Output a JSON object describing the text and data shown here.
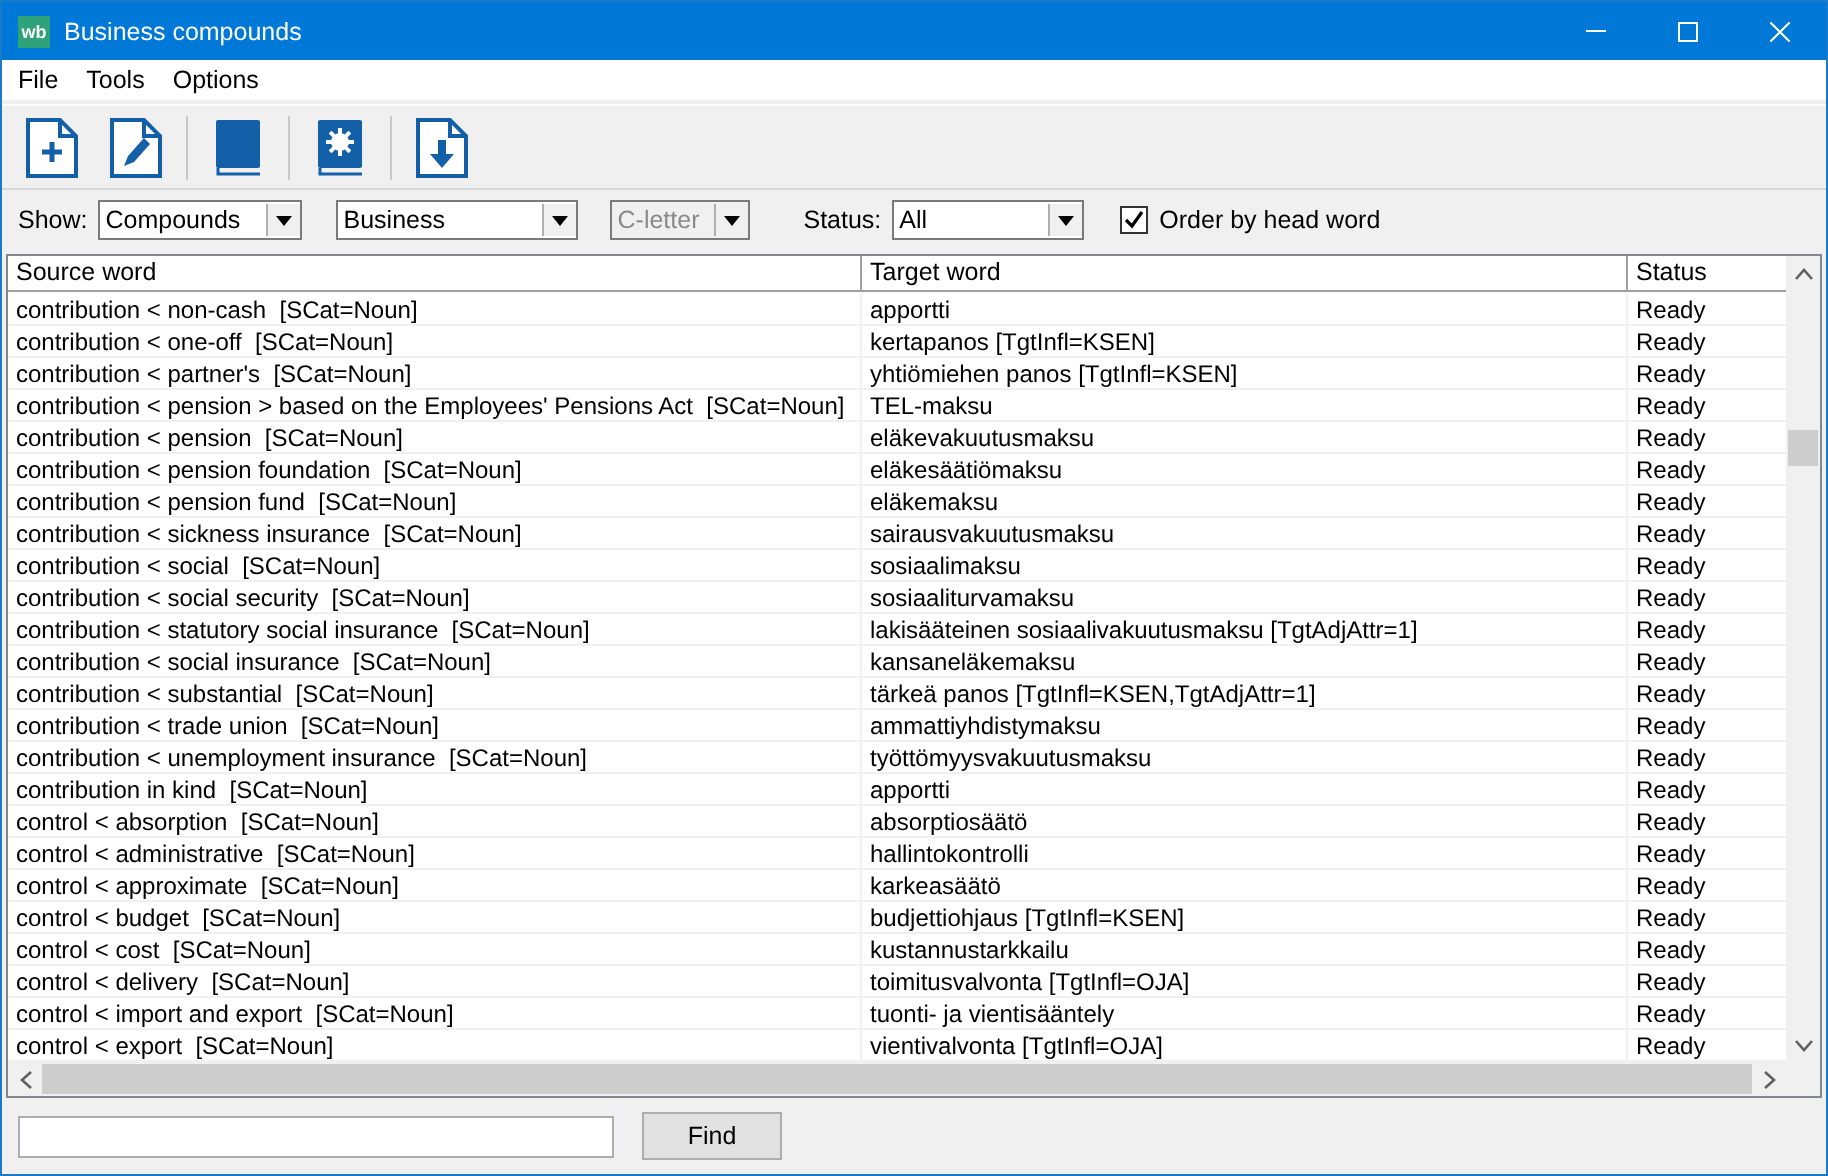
{
  "window": {
    "app_icon": "wb",
    "title": "Business compounds"
  },
  "menu": [
    "File",
    "Tools",
    "Options"
  ],
  "filters": {
    "show_label": "Show:",
    "dropdowns": [
      {
        "value": "Compounds",
        "disabled": false
      },
      {
        "value": "Business",
        "disabled": false
      },
      {
        "value": "C-letter",
        "disabled": true
      }
    ],
    "status_label": "Status:",
    "status": {
      "value": "All",
      "disabled": false
    },
    "order_checkbox": {
      "label": "Order by head word",
      "checked": true
    }
  },
  "table": {
    "columns": [
      "Source word",
      "Target word",
      "Status"
    ],
    "rows": [
      [
        "contribution < non-cash  [SCat=Noun]",
        "apportti",
        "Ready"
      ],
      [
        "contribution < one-off  [SCat=Noun]",
        "kertapanos [TgtInfl=KSEN]",
        "Ready"
      ],
      [
        "contribution < partner's  [SCat=Noun]",
        "yhtiömiehen panos [TgtInfl=KSEN]",
        "Ready"
      ],
      [
        "contribution < pension > based on the Employees' Pensions Act  [SCat=Noun]",
        "TEL-maksu",
        "Ready"
      ],
      [
        "contribution < pension  [SCat=Noun]",
        "eläkevakuutusmaksu",
        "Ready"
      ],
      [
        "contribution < pension foundation  [SCat=Noun]",
        "eläkesäätiömaksu",
        "Ready"
      ],
      [
        "contribution < pension fund  [SCat=Noun]",
        "eläkemaksu",
        "Ready"
      ],
      [
        "contribution < sickness insurance  [SCat=Noun]",
        "sairausvakuutusmaksu",
        "Ready"
      ],
      [
        "contribution < social  [SCat=Noun]",
        "sosiaalimaksu",
        "Ready"
      ],
      [
        "contribution < social security  [SCat=Noun]",
        "sosiaaliturvamaksu",
        "Ready"
      ],
      [
        "contribution < statutory social insurance  [SCat=Noun]",
        "lakisääteinen sosiaalivakuutusmaksu [TgtAdjAttr=1]",
        "Ready"
      ],
      [
        "contribution < social insurance  [SCat=Noun]",
        "kansaneläkemaksu",
        "Ready"
      ],
      [
        "contribution < substantial  [SCat=Noun]",
        "tärkeä panos [TgtInfl=KSEN,TgtAdjAttr=1]",
        "Ready"
      ],
      [
        "contribution < trade union  [SCat=Noun]",
        "ammattiyhdistymaksu",
        "Ready"
      ],
      [
        "contribution < unemployment insurance  [SCat=Noun]",
        "työttömyysvakuutusmaksu",
        "Ready"
      ],
      [
        "contribution in kind  [SCat=Noun]",
        "apportti",
        "Ready"
      ],
      [
        "control < absorption  [SCat=Noun]",
        "absorptiosäätö",
        "Ready"
      ],
      [
        "control < administrative  [SCat=Noun]",
        "hallintokontrolli",
        "Ready"
      ],
      [
        "control < approximate  [SCat=Noun]",
        "karkeasäätö",
        "Ready"
      ],
      [
        "control < budget  [SCat=Noun]",
        "budjettiohjaus [TgtInfl=KSEN]",
        "Ready"
      ],
      [
        "control < cost  [SCat=Noun]",
        "kustannustarkkailu",
        "Ready"
      ],
      [
        "control < delivery  [SCat=Noun]",
        "toimitusvalvonta [TgtInfl=OJA]",
        "Ready"
      ],
      [
        "control < import and export  [SCat=Noun]",
        "tuonti- ja vientisääntely",
        "Ready"
      ],
      [
        "control < export  [SCat=Noun]",
        "vientivalvonta [TgtInfl=OJA]",
        "Ready"
      ]
    ]
  },
  "find": {
    "button": "Find"
  }
}
